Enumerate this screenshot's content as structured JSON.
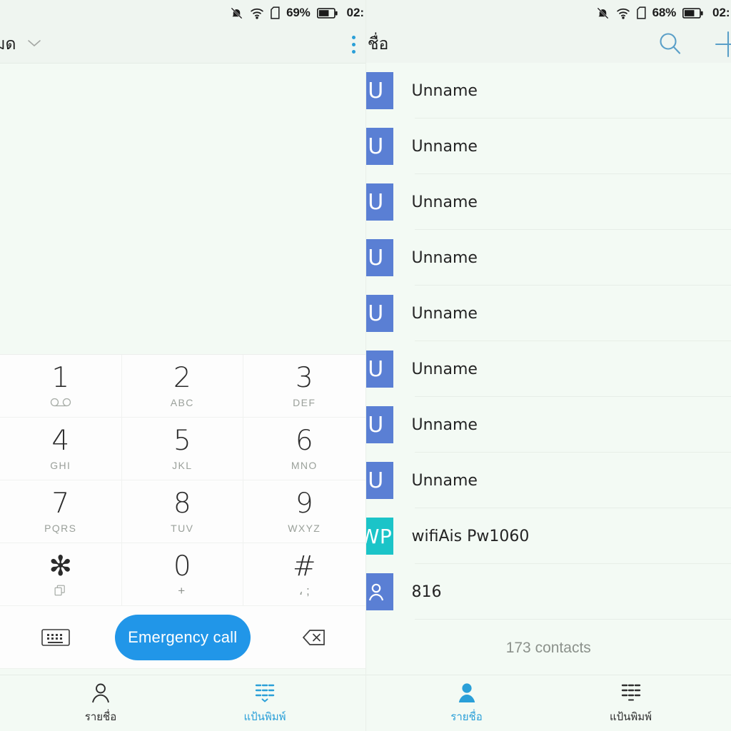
{
  "colors": {
    "accent_blue": "#2196e8",
    "icon_blue": "#2a9fd8",
    "avatar_blue": "#5a7fd4",
    "avatar_teal": "#1bc4c8",
    "page_bg": "#f3faf4",
    "bar_bg": "#eff5f0",
    "dialpad_bg": "#fdfdfd"
  },
  "left_panel": {
    "statusbar": {
      "mute_icon": "bell-muted-icon",
      "wifi_icon": "wifi-icon",
      "sim_icon": "sim-card-icon",
      "battery_percent": "69%",
      "battery_icon": "battery-icon",
      "clock": "02:"
    },
    "appbar": {
      "title": "ั้งหมด",
      "caret_icon": "chevron-down-icon",
      "overflow_icon": "kebab-menu-icon"
    },
    "dialpad": {
      "keys": [
        {
          "digit": "1",
          "sub": "",
          "sub_icon": "voicemail-icon"
        },
        {
          "digit": "2",
          "sub": "ABC",
          "sub_icon": ""
        },
        {
          "digit": "3",
          "sub": "DEF",
          "sub_icon": ""
        },
        {
          "digit": "4",
          "sub": "GHI",
          "sub_icon": ""
        },
        {
          "digit": "5",
          "sub": "JKL",
          "sub_icon": ""
        },
        {
          "digit": "6",
          "sub": "MNO",
          "sub_icon": ""
        },
        {
          "digit": "7",
          "sub": "PQRS",
          "sub_icon": ""
        },
        {
          "digit": "8",
          "sub": "TUV",
          "sub_icon": ""
        },
        {
          "digit": "9",
          "sub": "WXYZ",
          "sub_icon": ""
        },
        {
          "digit": "✻",
          "sub": "",
          "sub_icon": "copy-icon"
        },
        {
          "digit": "0",
          "sub": "+",
          "sub_icon": ""
        },
        {
          "digit": "#",
          "sub": "، ;",
          "sub_icon": ""
        }
      ]
    },
    "actions": {
      "keyboard_icon": "keyboard-icon",
      "emergency_label": "Emergency call",
      "backspace_icon": "backspace-icon"
    },
    "bottomnav": {
      "items": [
        {
          "label": "รายชื่อ",
          "icon": "person-outline-icon",
          "active": false
        },
        {
          "label": "แป้นพิมพ์",
          "icon": "dialpad-icon",
          "active": true
        }
      ]
    }
  },
  "right_panel": {
    "statusbar": {
      "mute_icon": "bell-muted-icon",
      "wifi_icon": "wifi-icon",
      "sim_icon": "sim-card-icon",
      "battery_percent": "68%",
      "battery_icon": "battery-icon",
      "clock": "02:"
    },
    "appbar": {
      "title": "ายชื่อ",
      "search_icon": "search-icon",
      "add_icon": "plus-icon"
    },
    "contacts": [
      {
        "name": "Unname",
        "initials": "U",
        "avatar_type": "letter",
        "color": "#5a7fd4"
      },
      {
        "name": "Unname",
        "initials": "U",
        "avatar_type": "letter",
        "color": "#5a7fd4"
      },
      {
        "name": "Unname",
        "initials": "U",
        "avatar_type": "letter",
        "color": "#5a7fd4"
      },
      {
        "name": "Unname",
        "initials": "U",
        "avatar_type": "letter",
        "color": "#5a7fd4"
      },
      {
        "name": "Unname",
        "initials": "U",
        "avatar_type": "letter",
        "color": "#5a7fd4"
      },
      {
        "name": "Unname",
        "initials": "U",
        "avatar_type": "letter",
        "color": "#5a7fd4"
      },
      {
        "name": "Unname",
        "initials": "U",
        "avatar_type": "letter",
        "color": "#5a7fd4"
      },
      {
        "name": "Unname",
        "initials": "U",
        "avatar_type": "letter",
        "color": "#5a7fd4"
      },
      {
        "name": "wifiAis Pw1060",
        "initials": "WP",
        "avatar_type": "letter",
        "color": "#1bc4c8"
      },
      {
        "name": "816",
        "initials": "",
        "avatar_type": "person",
        "color": "#5a7fd4"
      }
    ],
    "contacts_count": "173 contacts",
    "bottomnav": {
      "items": [
        {
          "label": "รายชื่อ",
          "icon": "person-filled-icon",
          "active": true
        },
        {
          "label": "แป้นพิมพ์",
          "icon": "dialpad-icon",
          "active": false
        }
      ]
    }
  }
}
